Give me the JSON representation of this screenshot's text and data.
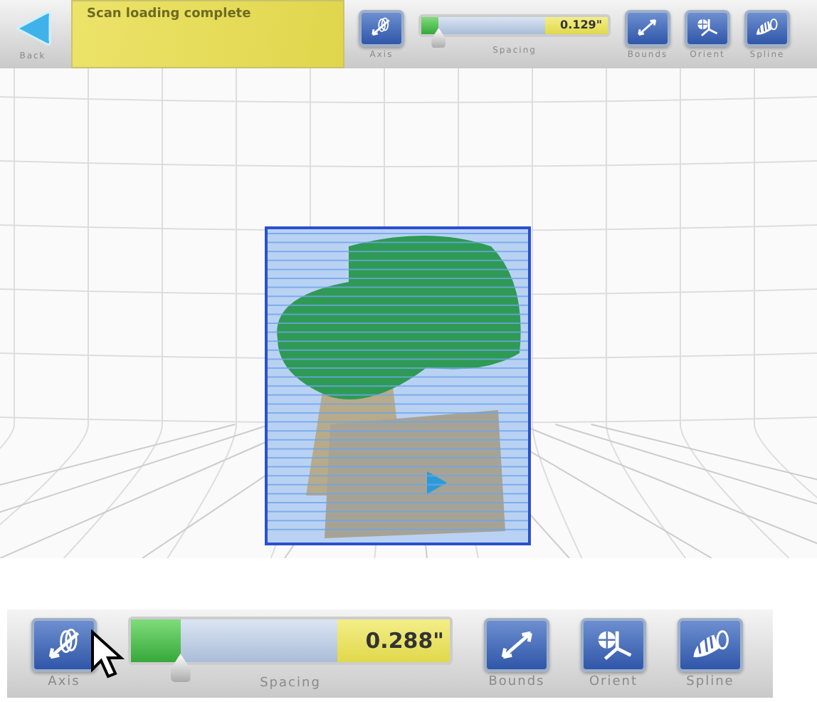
{
  "top_toolbar": {
    "back_button": {
      "label": "Back"
    },
    "status": "Scan loading complete",
    "tools": [
      {
        "kind": "axis",
        "label": "Axis"
      },
      {
        "kind": "slider",
        "label": "Spacing",
        "level": 0.14,
        "reading": "0.129\""
      },
      {
        "kind": "bounds",
        "label": "Bounds"
      },
      {
        "kind": "orient",
        "label": "Orient"
      },
      {
        "kind": "spline",
        "label": "Spline"
      }
    ]
  },
  "bottom_toolbar": {
    "tools": [
      {
        "kind": "axis",
        "label": "Axis"
      },
      {
        "kind": "slider",
        "label": "Spacing",
        "level": 0.24,
        "reading": "0.288\""
      },
      {
        "kind": "bounds",
        "label": "Bounds"
      },
      {
        "kind": "orient",
        "label": "Orient"
      },
      {
        "kind": "spline",
        "label": "Spline"
      }
    ]
  }
}
